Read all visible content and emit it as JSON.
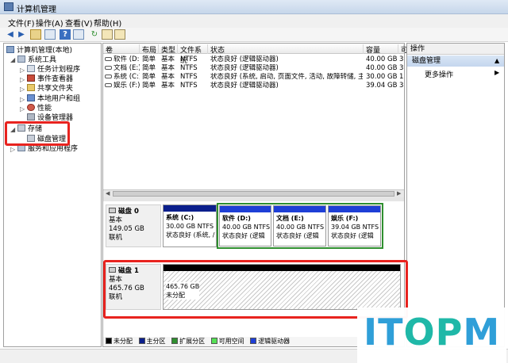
{
  "window": {
    "title": "计算机管理"
  },
  "menu": [
    "文件(F)",
    "操作(A)",
    "查看(V)",
    "帮助(H)"
  ],
  "tree": {
    "root": "计算机管理(本地)",
    "items": [
      "系统工具",
      "任务计划程序",
      "事件查看器",
      "共享文件夹",
      "本地用户和组",
      "性能",
      "设备管理器",
      "存储",
      "磁盘管理",
      "服务和应用程序"
    ]
  },
  "volumes": {
    "headers": [
      "卷",
      "布局",
      "类型",
      "文件系统",
      "状态",
      "容量",
      "可"
    ],
    "rows": [
      {
        "name": "软件 (D:)",
        "layout": "简单",
        "type": "基本",
        "fs": "NTFS",
        "status": "状态良好 (逻辑驱动器)",
        "capacity": "40.00 GB",
        "free": "39"
      },
      {
        "name": "文档 (E:)",
        "layout": "简单",
        "type": "基本",
        "fs": "NTFS",
        "status": "状态良好 (逻辑驱动器)",
        "capacity": "40.00 GB",
        "free": "39"
      },
      {
        "name": "系统 (C:)",
        "layout": "简单",
        "type": "基本",
        "fs": "NTFS",
        "status": "状态良好 (系统, 启动, 页面文件, 活动, 故障转储, 主分区)",
        "capacity": "30.00 GB",
        "free": "18"
      },
      {
        "name": "娱乐 (F:)",
        "layout": "简单",
        "type": "基本",
        "fs": "NTFS",
        "status": "状态良好 (逻辑驱动器)",
        "capacity": "39.04 GB",
        "free": "38"
      }
    ]
  },
  "disk0": {
    "label": "磁盘 0",
    "type": "基本",
    "size": "149.05 GB",
    "state": "联机",
    "partitions": [
      {
        "name": "系统 (C:)",
        "size": "30.00 GB NTFS",
        "status": "状态良好 (系统, /"
      },
      {
        "name": "软件 (D:)",
        "size": "40.00 GB NTFS",
        "status": "状态良好 (逻辑"
      },
      {
        "name": "文档 (E:)",
        "size": "40.00 GB NTFS",
        "status": "状态良好 (逻辑"
      },
      {
        "name": "娱乐 (F:)",
        "size": "39.04 GB NTFS",
        "status": "状态良好 (逻辑"
      }
    ]
  },
  "disk1": {
    "label": "磁盘 1",
    "type": "基本",
    "size": "465.76 GB",
    "state": "联机",
    "unallocated": {
      "size": "465.76 GB",
      "label": "未分配"
    }
  },
  "legend": [
    {
      "label": "未分配",
      "color": "#000000"
    },
    {
      "label": "主分区",
      "color": "#0b1f8c"
    },
    {
      "label": "扩展分区",
      "color": "#2f8f2f"
    },
    {
      "label": "可用空间",
      "color": "#55e055"
    },
    {
      "label": "逻辑驱动器",
      "color": "#1e3fd6"
    }
  ],
  "actions": {
    "header": "操作",
    "selected": "磁盘管理",
    "more": "更多操作"
  },
  "watermark": {
    "text": "ITOPM"
  }
}
